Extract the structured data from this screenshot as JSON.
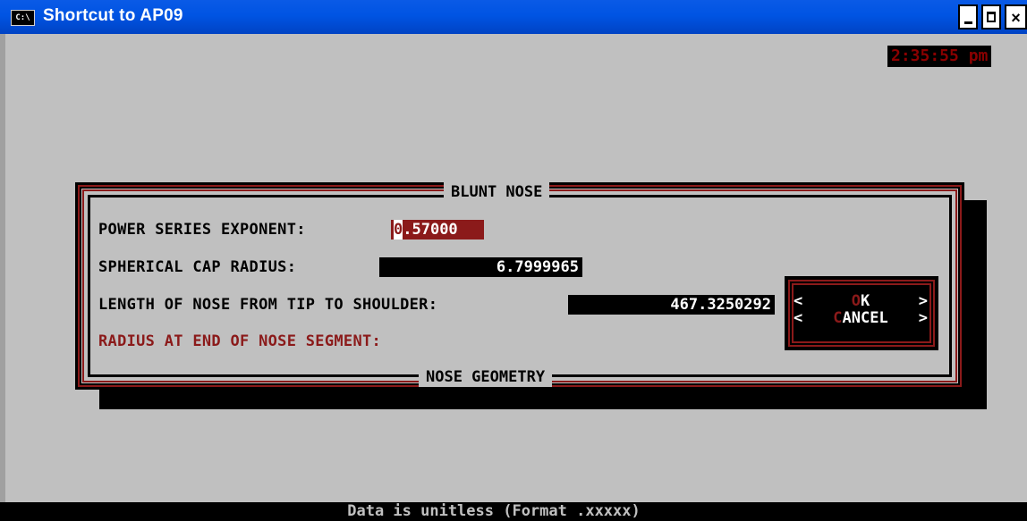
{
  "window": {
    "title": "Shortcut to AP09",
    "icon_label": "C:\\",
    "icon": "console-icon",
    "controls": {
      "minimize": "minimize-icon",
      "maximize": "maximize-icon",
      "close": "close-icon",
      "close_glyph": "×"
    }
  },
  "clock": {
    "time": "2:35:55 pm"
  },
  "dialog": {
    "title": "BLUNT NOSE",
    "footer": "NOSE GEOMETRY",
    "fields": [
      {
        "label": "POWER SERIES EXPONENT:",
        "value": "0.57000",
        "active": true
      },
      {
        "label": "SPHERICAL CAP RADIUS:",
        "value": "6.7999965"
      },
      {
        "label": "LENGTH OF NOSE FROM TIP TO SHOULDER:",
        "value": "467.3250292"
      },
      {
        "label": "RADIUS AT END OF NOSE SEGMENT:",
        "value": "",
        "highlighted": true
      }
    ],
    "buttons": {
      "ok": {
        "left": "<",
        "hotkey": "O",
        "rest": "K",
        "right": ">"
      },
      "cancel": {
        "left": "<",
        "hotkey": "C",
        "rest": "ANCEL",
        "right": ">"
      }
    }
  },
  "status": {
    "text": "Data is unitless (Format .xxxxx)"
  },
  "colors": {
    "titlebar": "#0054e3",
    "console_bg": "#c0c0c0",
    "accent_red": "#8b1a1a",
    "field_bg": "#000000"
  }
}
